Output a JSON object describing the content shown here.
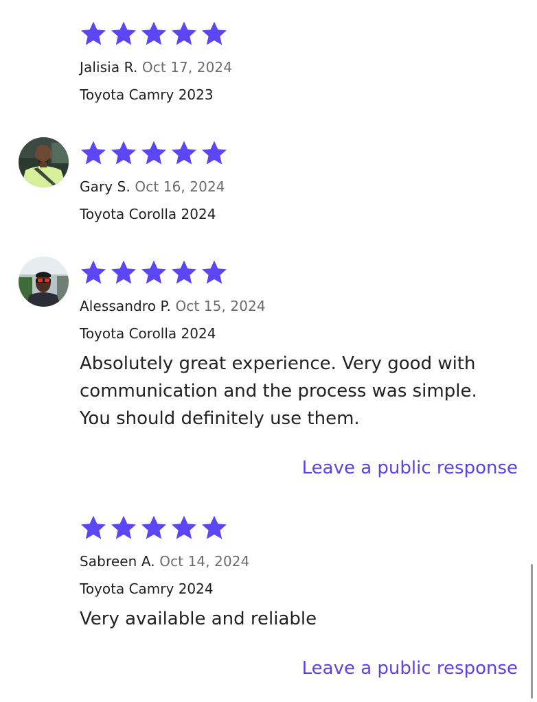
{
  "colors": {
    "star": "#5b45f5",
    "link": "#5a45e0",
    "date": "#6b6b6b"
  },
  "reviews": [
    {
      "rating": 5,
      "reviewer": "Jalisia R.",
      "date": "Oct 17, 2024",
      "vehicle": "Toyota Camry 2023",
      "has_avatar": false
    },
    {
      "rating": 5,
      "reviewer": "Gary S.",
      "date": "Oct 16, 2024",
      "vehicle": "Toyota Corolla 2024",
      "has_avatar": true
    },
    {
      "rating": 5,
      "reviewer": "Alessandro P.",
      "date": "Oct 15, 2024",
      "vehicle": "Toyota Corolla 2024",
      "has_avatar": true,
      "text": "Absolutely great experience. Very good with communication and the process was simple. You should definitely use them.",
      "response_link": "Leave a public response"
    },
    {
      "rating": 5,
      "reviewer": "Sabreen A.",
      "date": "Oct 14, 2024",
      "vehicle": "Toyota Camry 2024",
      "has_avatar": false,
      "text": "Very available and reliable",
      "response_link": "Leave a public response"
    }
  ]
}
